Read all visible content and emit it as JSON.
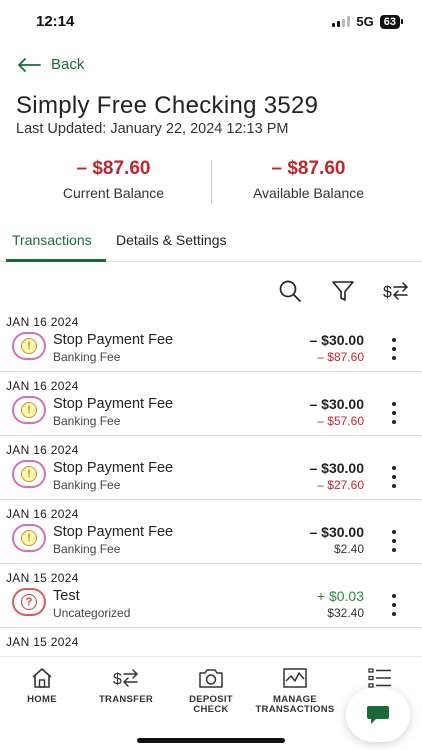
{
  "status_bar": {
    "time": "12:14",
    "network": "5G",
    "battery": "63"
  },
  "header": {
    "back_label": "Back",
    "title": "Simply Free Checking 3529",
    "last_updated": "Last Updated: January 22, 2024 12:13 PM"
  },
  "balances": {
    "current": {
      "amount": "– $87.60",
      "label": "Current Balance"
    },
    "available": {
      "amount": "– $87.60",
      "label": "Available Balance"
    }
  },
  "tabs": [
    {
      "label": "Transactions",
      "active": true
    },
    {
      "label": "Details & Settings",
      "active": false
    }
  ],
  "tools": [
    "search-icon",
    "filter-icon",
    "dollar-transfer-icon"
  ],
  "transactions": [
    {
      "date": "JAN 16 2024",
      "name": "Stop Payment Fee",
      "category": "Banking Fee",
      "amount": "– $30.00",
      "balance": "– $87.60",
      "icon": "fee-alert-icon"
    },
    {
      "date": "JAN 16 2024",
      "name": "Stop Payment Fee",
      "category": "Banking Fee",
      "amount": "– $30.00",
      "balance": "– $57.60",
      "icon": "fee-alert-icon"
    },
    {
      "date": "JAN 16 2024",
      "name": "Stop Payment Fee",
      "category": "Banking Fee",
      "amount": "– $30.00",
      "balance": "– $27.60",
      "icon": "fee-alert-icon"
    },
    {
      "date": "JAN 16 2024",
      "name": "Stop Payment Fee",
      "category": "Banking Fee",
      "amount": "– $30.00",
      "balance": "$2.40",
      "icon": "fee-alert-icon"
    },
    {
      "date": "JAN 15 2024",
      "name": "Test",
      "category": "Uncategorized",
      "amount": "+ $0.03",
      "balance": "$32.40",
      "icon": "uncategorized-question-icon"
    },
    {
      "date": "JAN 15 2024"
    }
  ],
  "bottom_nav": [
    {
      "label": "HOME",
      "icon": "home-icon"
    },
    {
      "label": "TRANSFER",
      "icon": "transfer-icon"
    },
    {
      "label": "DEPOSIT\nCHECK",
      "icon": "camera-icon"
    },
    {
      "label": "MANAGE\nTRANSACTIONS",
      "icon": "chart-icon"
    },
    {
      "label": "",
      "icon": "list-icon"
    }
  ],
  "colors": {
    "brand_green": "#1a6b3a",
    "negative_red": "#c0262d",
    "positive_green": "#2a8a3e"
  }
}
